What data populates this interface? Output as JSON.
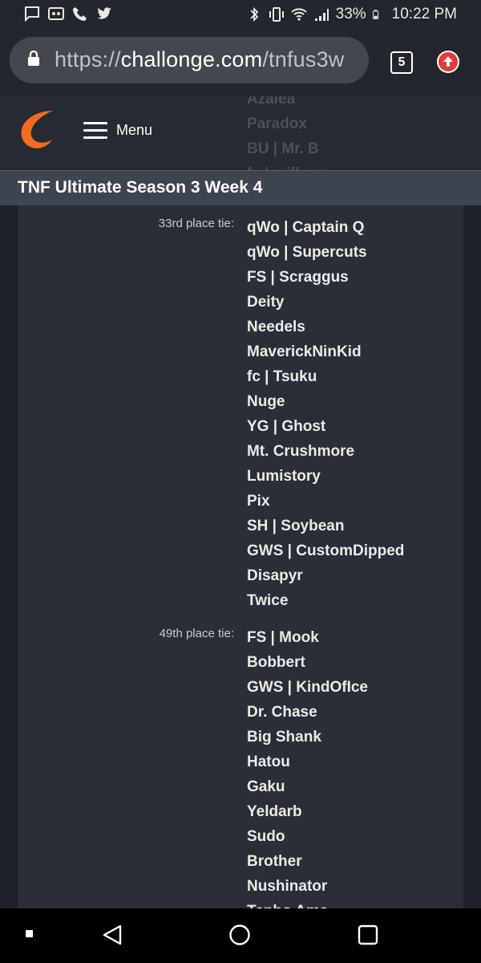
{
  "status_bar": {
    "left_icons": [
      "message-icon",
      "voicemail-icon",
      "call-icon",
      "twitter-icon"
    ],
    "right_icons": [
      "bluetooth-icon",
      "vibrate-icon",
      "wifi-icon",
      "signal-icon",
      "battery-icon"
    ],
    "battery_percent": "33%",
    "time": "10:22 PM"
  },
  "browser": {
    "url_prefix": "https://",
    "url_host": "challonge.com",
    "url_path": "/tnfus3w",
    "tab_count": "5"
  },
  "header": {
    "menu_label": "Menu",
    "background_names": [
      "Azalea",
      "Paradox",
      "BU | Mr. B",
      "fc | milkcup"
    ]
  },
  "page": {
    "title": "TNF Ultimate Season 3 Week 4"
  },
  "standings": [
    {
      "place": "33rd place tie:",
      "players": [
        "qWo | Captain Q",
        "qWo | Supercuts",
        "FS | Scraggus",
        "Deity",
        "Needels",
        "MaverickNinKid",
        "fc | Tsuku",
        "Nuge",
        "YG | Ghost",
        "Mt. Crushmore",
        "Lumistory",
        "Pix",
        "SH | Soybean",
        "GWS | CustomDipped",
        "Disapyr",
        "Twice"
      ]
    },
    {
      "place": "49th place tie:",
      "players": [
        "FS | Mook",
        "Bobbert",
        "GWS | KindOfIce",
        "Dr. Chase",
        "Big Shank",
        "Hatou",
        "Gaku",
        "Yeldarb",
        "Sudo",
        "Brother",
        "Nushinator",
        "Tenho Ama"
      ]
    }
  ],
  "colors": {
    "accent": "#f26b21",
    "background": "#1e2129",
    "panel": "#2a2e37",
    "titlebar": "#3e4450"
  }
}
